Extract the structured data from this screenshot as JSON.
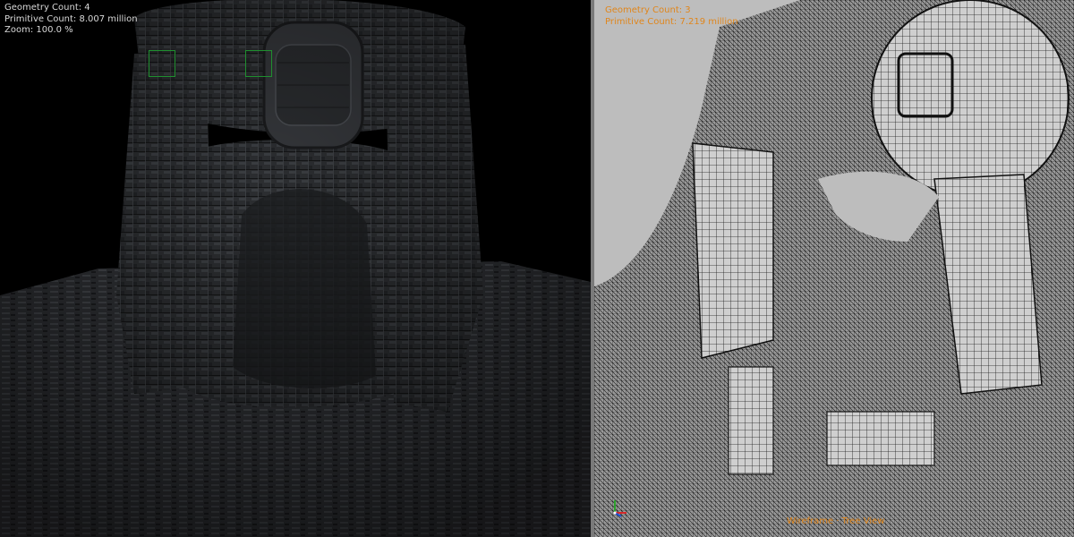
{
  "left_viewport": {
    "hud": {
      "geometry_count": "Geometry Count: 4",
      "primitive_count": "Primitive Count: 8.007 million",
      "zoom": "Zoom: 100.0 %"
    },
    "shading": "shaded"
  },
  "right_viewport": {
    "hud": {
      "geometry_count": "Geometry Count: 3",
      "primitive_count": "Primitive Count: 7.219 million"
    },
    "status": "Wireframe · Tree View",
    "shading": "wireframe"
  },
  "colors": {
    "hud_left_text": "#d8d8d8",
    "hud_right_text": "#e0861c",
    "selection_box": "#1f8f2f",
    "right_background": "#bdbdbd"
  },
  "icons": [
    "axis-gizmo-icon"
  ]
}
